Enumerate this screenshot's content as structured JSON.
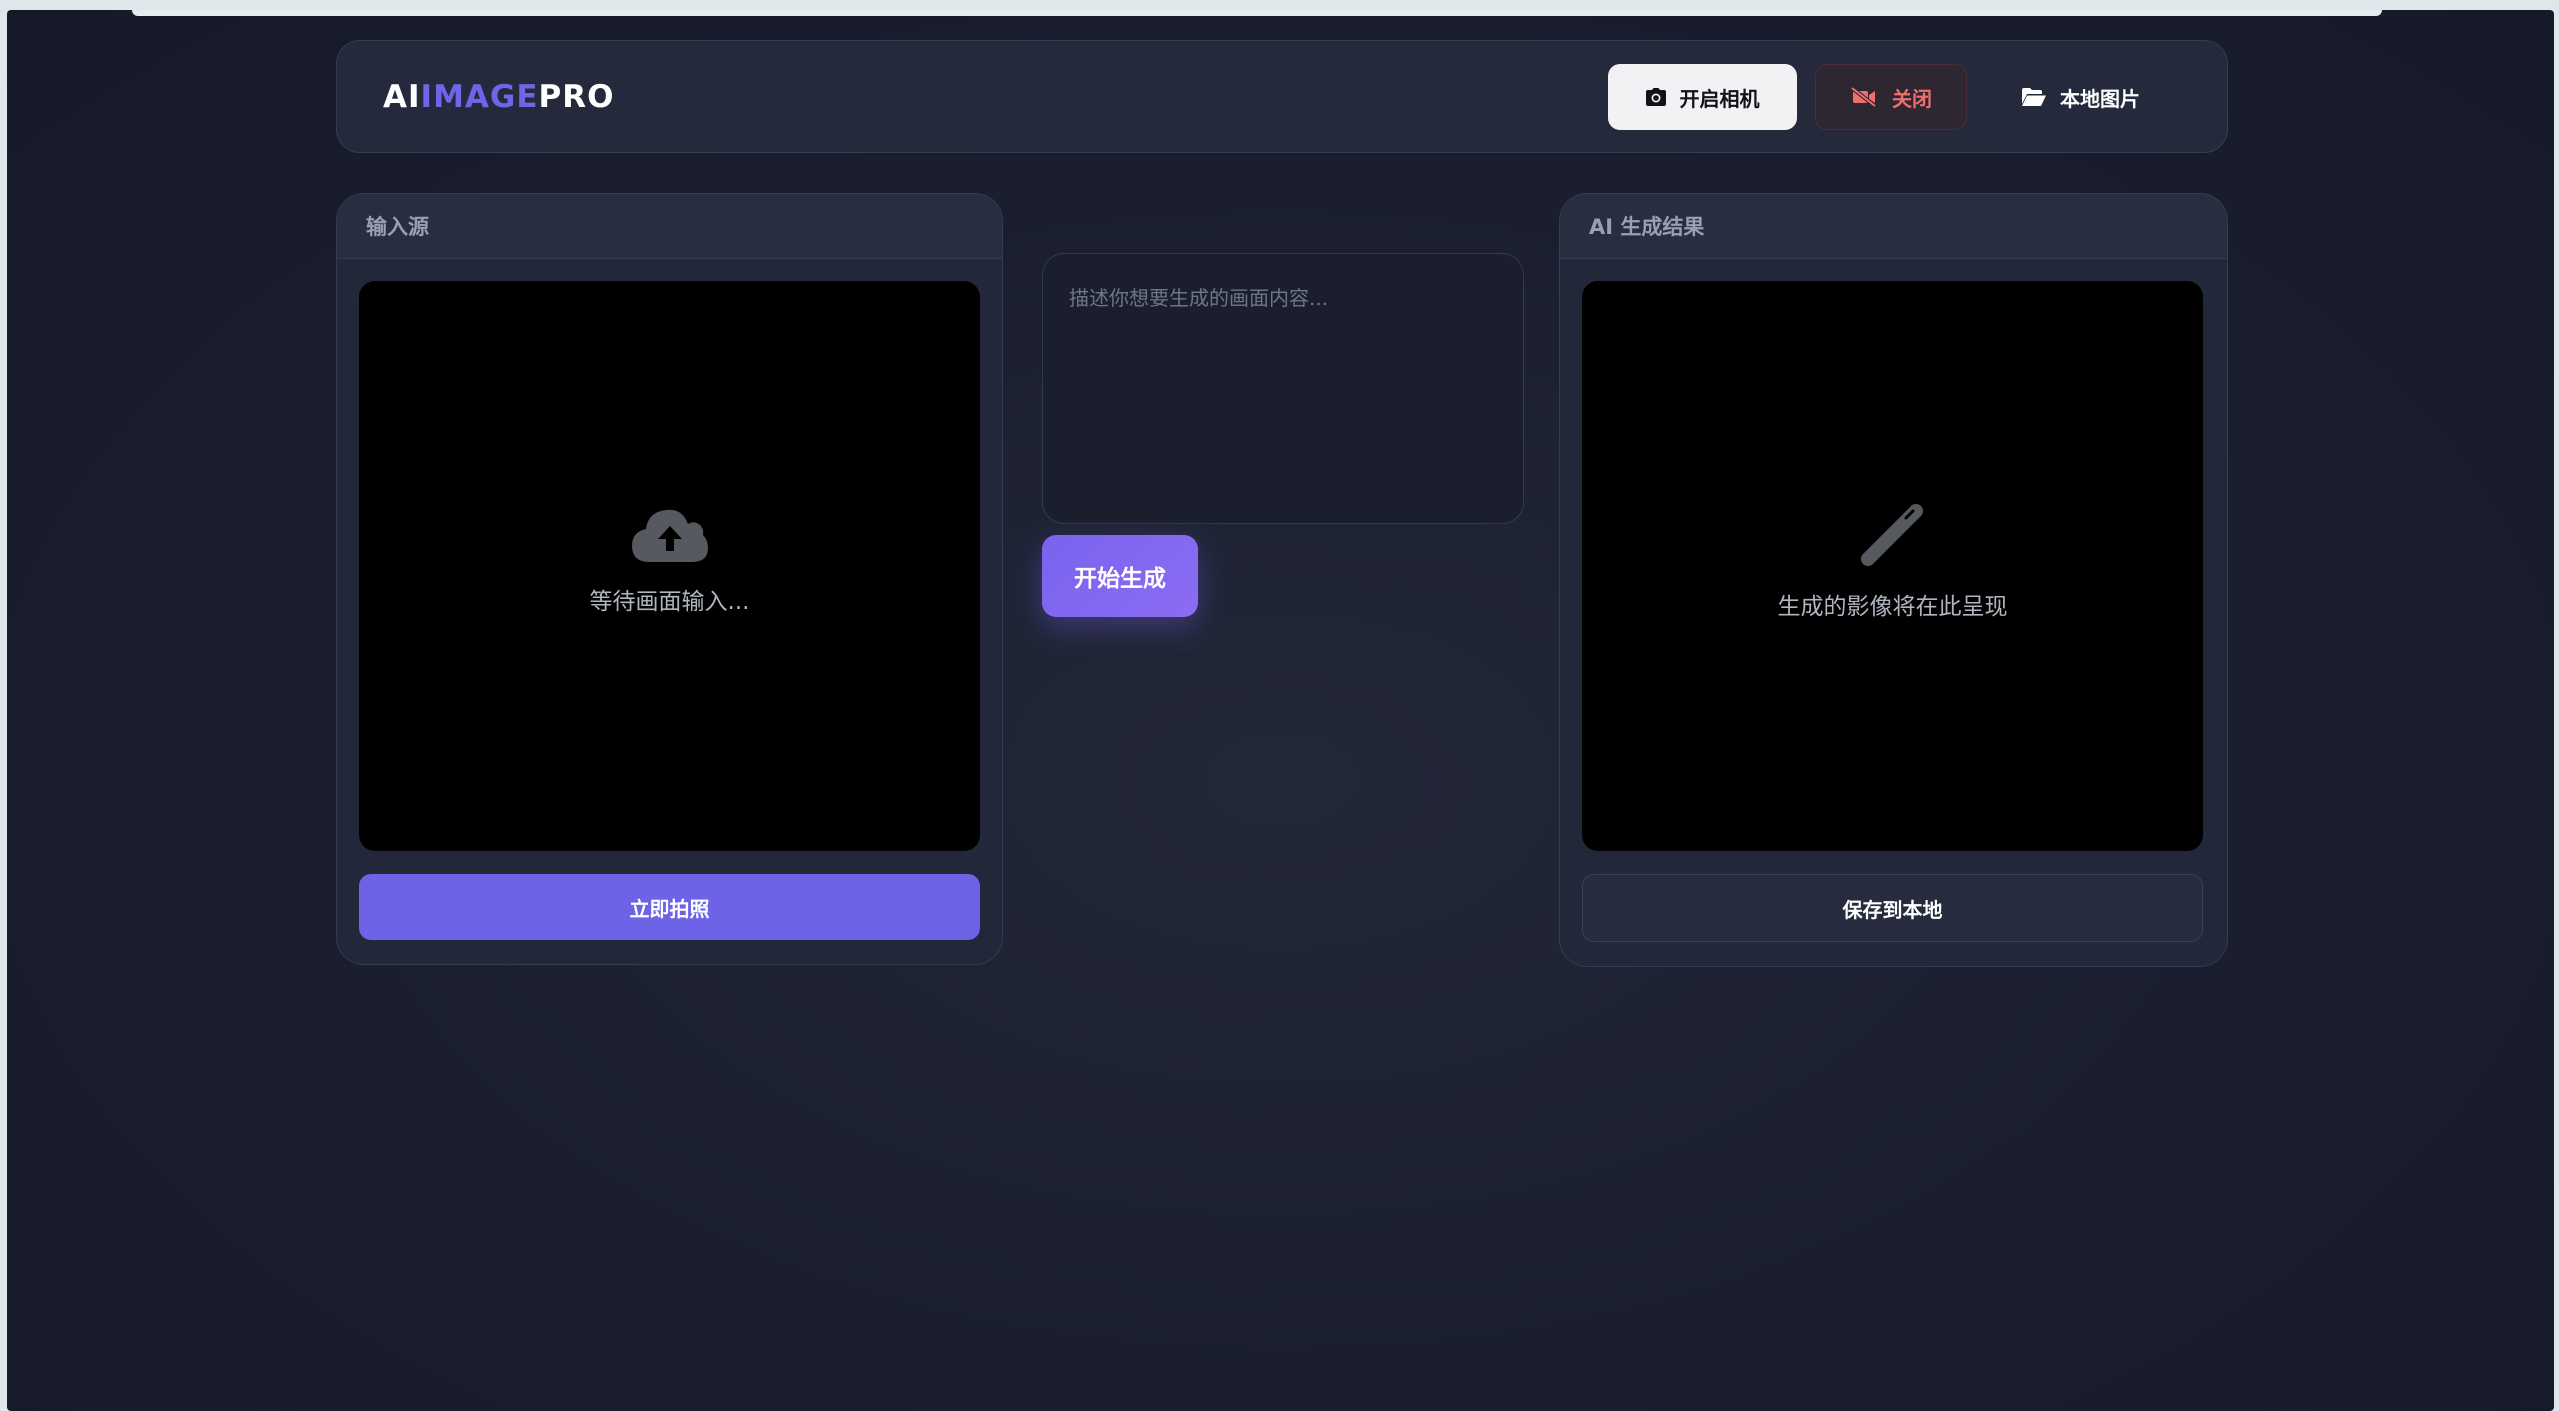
{
  "header": {
    "logo": {
      "part1": "AI",
      "part2": "IMAGE",
      "part3": "PRO"
    },
    "buttons": {
      "open_camera": "开启相机",
      "close": "关闭",
      "local_image": "本地图片"
    }
  },
  "input_panel": {
    "title": "输入源",
    "placeholder_icon": "cloud-upload-icon",
    "placeholder_text": "等待画面输入...",
    "snap_button": "立即拍照"
  },
  "prompt": {
    "placeholder": "描述你想要生成的画面内容...",
    "value": ""
  },
  "generate_button": "开始生成",
  "result_panel": {
    "title": "AI 生成结果",
    "placeholder_icon": "magic-wand-icon",
    "placeholder_text": "生成的影像将在此呈现",
    "save_button": "保存到本地"
  },
  "colors": {
    "accent": "#6c63e6",
    "generate": "#7a63ee",
    "danger": "#ef6f6f",
    "background": "#1a1e2e"
  }
}
